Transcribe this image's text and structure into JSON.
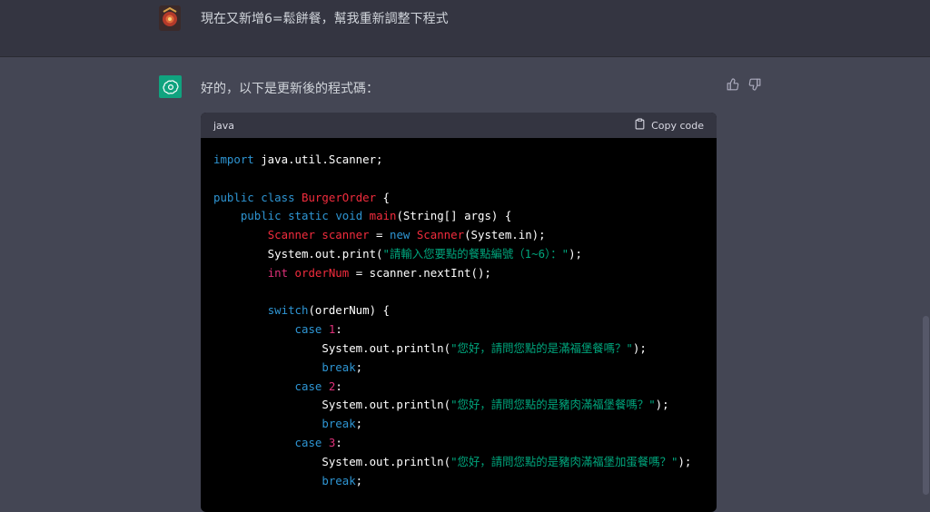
{
  "user_message": "現在又新增6=鬆餅餐，幫我重新調整下程式",
  "assistant_intro": "好的，以下是更新後的程式碼：",
  "code": {
    "language": "java",
    "copy_label": "Copy code",
    "lines": [
      [
        {
          "t": "import",
          "c": "kw"
        },
        {
          "t": " java.util.Scanner;",
          "c": ""
        }
      ],
      [],
      [
        {
          "t": "public",
          "c": "kw"
        },
        {
          "t": " ",
          "c": ""
        },
        {
          "t": "class",
          "c": "kw"
        },
        {
          "t": " ",
          "c": ""
        },
        {
          "t": "BurgerOrder",
          "c": "cls"
        },
        {
          "t": " {",
          "c": ""
        }
      ],
      [
        {
          "t": "    ",
          "c": ""
        },
        {
          "t": "public",
          "c": "kw"
        },
        {
          "t": " ",
          "c": ""
        },
        {
          "t": "static",
          "c": "kw"
        },
        {
          "t": " ",
          "c": ""
        },
        {
          "t": "void",
          "c": "kw"
        },
        {
          "t": " ",
          "c": ""
        },
        {
          "t": "main",
          "c": "cls"
        },
        {
          "t": "(String[] args) {",
          "c": ""
        }
      ],
      [
        {
          "t": "        ",
          "c": ""
        },
        {
          "t": "Scanner",
          "c": "cls"
        },
        {
          "t": " ",
          "c": ""
        },
        {
          "t": "scanner",
          "c": "cls"
        },
        {
          "t": " = ",
          "c": ""
        },
        {
          "t": "new",
          "c": "kw"
        },
        {
          "t": " ",
          "c": ""
        },
        {
          "t": "Scanner",
          "c": "cls"
        },
        {
          "t": "(System.in);",
          "c": ""
        }
      ],
      [
        {
          "t": "        System.out.print(",
          "c": ""
        },
        {
          "t": "\"請輸入您要點的餐點編號（1~6）：\"",
          "c": "str"
        },
        {
          "t": ");",
          "c": ""
        }
      ],
      [
        {
          "t": "        ",
          "c": ""
        },
        {
          "t": "int",
          "c": "num"
        },
        {
          "t": " ",
          "c": ""
        },
        {
          "t": "orderNum",
          "c": "cls"
        },
        {
          "t": " = scanner.nextInt();",
          "c": ""
        }
      ],
      [],
      [
        {
          "t": "        ",
          "c": ""
        },
        {
          "t": "switch",
          "c": "kw"
        },
        {
          "t": "(orderNum) {",
          "c": ""
        }
      ],
      [
        {
          "t": "            ",
          "c": ""
        },
        {
          "t": "case",
          "c": "kw"
        },
        {
          "t": " ",
          "c": ""
        },
        {
          "t": "1",
          "c": "num"
        },
        {
          "t": ":",
          "c": ""
        }
      ],
      [
        {
          "t": "                System.out.println(",
          "c": ""
        },
        {
          "t": "\"您好，請問您點的是滿福堡餐嗎？\"",
          "c": "str"
        },
        {
          "t": ");",
          "c": ""
        }
      ],
      [
        {
          "t": "                ",
          "c": ""
        },
        {
          "t": "break",
          "c": "kw"
        },
        {
          "t": ";",
          "c": ""
        }
      ],
      [
        {
          "t": "            ",
          "c": ""
        },
        {
          "t": "case",
          "c": "kw"
        },
        {
          "t": " ",
          "c": ""
        },
        {
          "t": "2",
          "c": "num"
        },
        {
          "t": ":",
          "c": ""
        }
      ],
      [
        {
          "t": "                System.out.println(",
          "c": ""
        },
        {
          "t": "\"您好，請問您點的是豬肉滿福堡餐嗎？\"",
          "c": "str"
        },
        {
          "t": ");",
          "c": ""
        }
      ],
      [
        {
          "t": "                ",
          "c": ""
        },
        {
          "t": "break",
          "c": "kw"
        },
        {
          "t": ";",
          "c": ""
        }
      ],
      [
        {
          "t": "            ",
          "c": ""
        },
        {
          "t": "case",
          "c": "kw"
        },
        {
          "t": " ",
          "c": ""
        },
        {
          "t": "3",
          "c": "num"
        },
        {
          "t": ":",
          "c": ""
        }
      ],
      [
        {
          "t": "                System.out.println(",
          "c": ""
        },
        {
          "t": "\"您好，請問您點的是豬肉滿福堡加蛋餐嗎？\"",
          "c": "str"
        },
        {
          "t": ");",
          "c": ""
        }
      ],
      [
        {
          "t": "                ",
          "c": ""
        },
        {
          "t": "break",
          "c": "kw"
        },
        {
          "t": ";",
          "c": ""
        }
      ]
    ]
  },
  "colors": {
    "keyword": "#2e95d3",
    "class_name": "#f22c3d",
    "number": "#df3079",
    "string": "#00a67d",
    "gpt_brand": "#10a37f"
  },
  "icons": {
    "user_avatar": "user-avatar-icon",
    "assistant_avatar": "openai-logo-icon",
    "thumbs_up": "thumbs-up-icon",
    "thumbs_down": "thumbs-down-icon",
    "copy": "clipboard-icon"
  }
}
